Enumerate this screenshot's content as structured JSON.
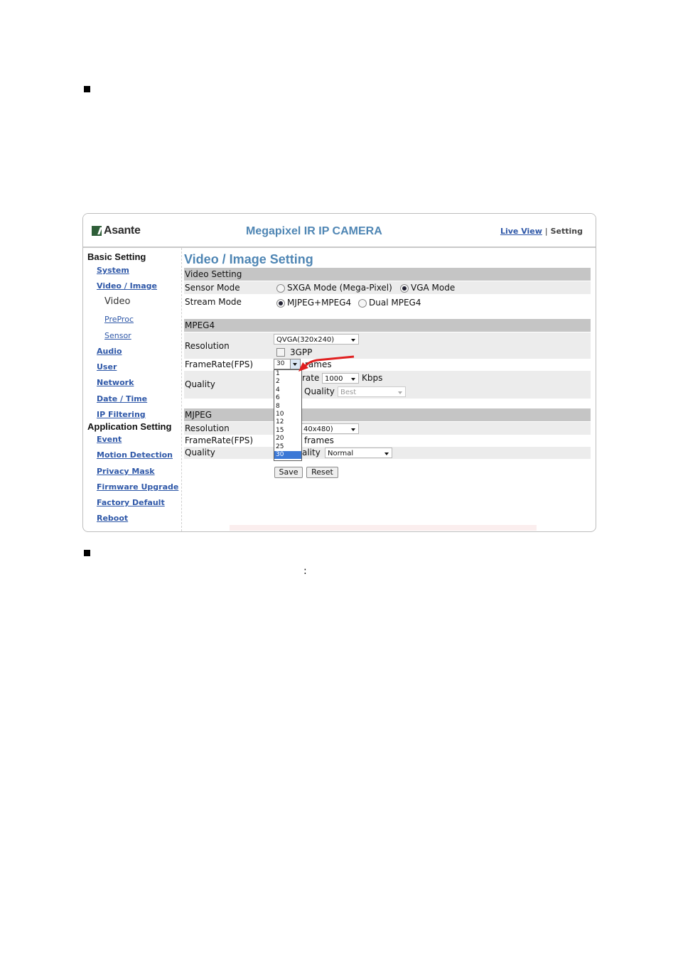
{
  "page": {
    "colon": ":"
  },
  "header": {
    "logo_text": "Asante",
    "app_title": "Megapixel IR IP CAMERA",
    "live_view": "Live View",
    "separator": "|",
    "setting": "Setting"
  },
  "sidebar": {
    "basic_heading": "Basic Setting",
    "system": "System",
    "video_image": "Video / Image",
    "video": "Video",
    "preproc": "PreProc",
    "sensor": "Sensor",
    "audio": "Audio",
    "user": "User",
    "network": "Network",
    "date_time": "Date / Time",
    "ip_filtering": "IP Filtering",
    "app_heading": "Application Setting",
    "event": "Event",
    "motion": "Motion Detection",
    "privacy": "Privacy Mask",
    "firmware": "Firmware Upgrade",
    "factory": "Factory Default",
    "reboot": "Reboot"
  },
  "main": {
    "title": "Video / Image Setting",
    "video_setting": "Video Setting",
    "sensor_mode_label": "Sensor Mode",
    "sxga": "SXGA Mode (Mega-Pixel)",
    "vga": "VGA Mode",
    "stream_mode_label": "Stream Mode",
    "mjpeg_mpeg4": "MJPEG+MPEG4",
    "dual_mpeg4": "Dual MPEG4",
    "mpeg4": {
      "heading": "MPEG4",
      "resolution_label": "Resolution",
      "resolution_value": "QVGA(320x240)",
      "threegpp": "3GPP",
      "framerate_label": "FrameRate(FPS)",
      "framerate_value": "30",
      "frames_suffix": "rames",
      "quality_label": "Quality",
      "bitrate_partial": "rate",
      "bitrate_value": "1000",
      "kbps": "Kbps",
      "quality_partial": "Quality",
      "quality_value": "Best"
    },
    "mjpeg": {
      "heading": "MJPEG",
      "resolution_label": "Resolution",
      "resolution_partial": "40x480)",
      "framerate_label": "FrameRate(FPS)",
      "frames": "frames",
      "quality_label": "Quality",
      "quality_partial": "ality",
      "quality_value": "Normal"
    },
    "fps_options": [
      "1",
      "2",
      "4",
      "6",
      "8",
      "10",
      "12",
      "15",
      "20",
      "25",
      "30"
    ],
    "fps_selected_index": 10,
    "save": "Save",
    "reset": "Reset"
  },
  "colors": {
    "accent": "#4f86b4",
    "link": "#2f58a8",
    "bar": "#c5c5c5",
    "arrow": "#e02020"
  }
}
